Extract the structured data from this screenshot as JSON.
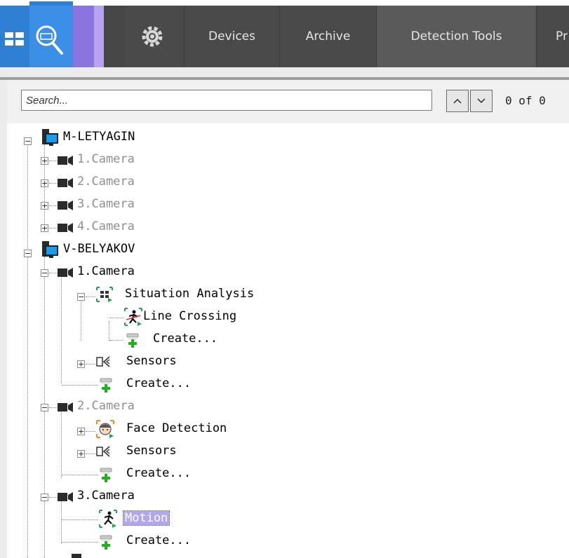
{
  "toolbar": {
    "tabs": [
      {
        "label": "Devices"
      },
      {
        "label": "Archive"
      },
      {
        "label": "Detection Tools"
      },
      {
        "label": "Pr"
      }
    ]
  },
  "search": {
    "placeholder": "Search...",
    "up_label": "^",
    "down_label": "v",
    "count": "0 of 0"
  },
  "tree": {
    "servers": [
      {
        "name": "M-LETYAGIN",
        "cameras": [
          "1.Camera",
          "2.Camera",
          "3.Camera",
          "4.Camera"
        ]
      },
      {
        "name": "V-BELYAKOV",
        "camera1": {
          "name": "1.Camera",
          "situation_analysis": "Situation Analysis",
          "line_crossing": "Line Crossing",
          "create_sa": "Create...",
          "sensors": "Sensors",
          "create": "Create..."
        },
        "camera2": {
          "name": "2.Camera",
          "face_detection": "Face Detection",
          "sensors": "Sensors",
          "create": "Create..."
        },
        "camera3": {
          "name": "3.Camera",
          "motion": "Motion",
          "create": "Create..."
        }
      }
    ]
  },
  "colors": {
    "accent_blue": "#3b8fe4",
    "accent_purple": "#8a74e0",
    "selection": "#b3a6ee"
  }
}
